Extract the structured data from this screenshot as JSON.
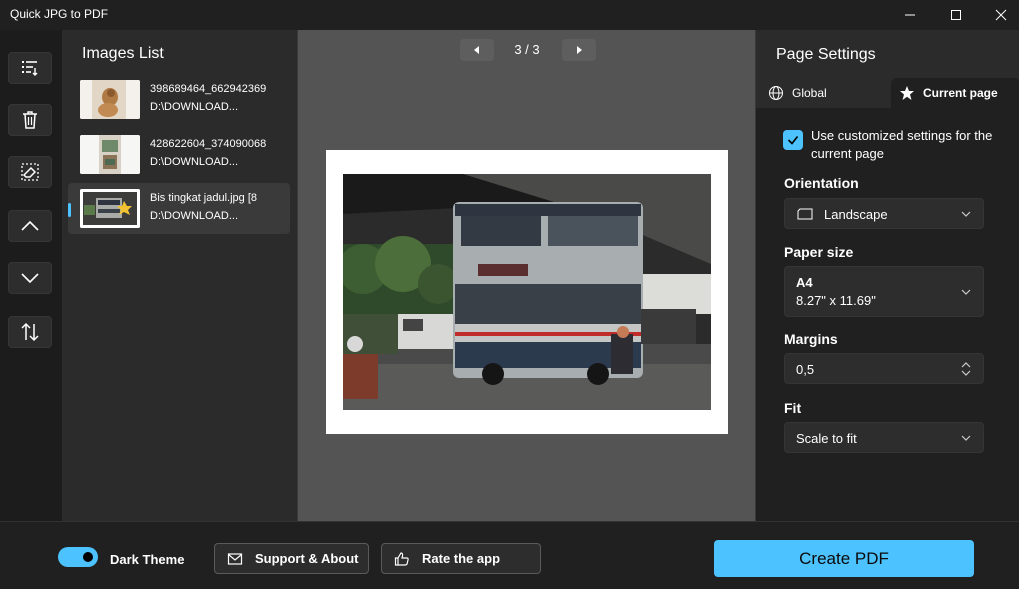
{
  "app": {
    "title": "Quick JPG to PDF"
  },
  "window_controls": [
    "minimize-icon",
    "maximize-icon",
    "close-icon"
  ],
  "toolbar": {
    "icons": [
      "list-options-icon",
      "delete-icon",
      "eraser-icon",
      "move-up-icon",
      "move-down-icon",
      "sort-icon"
    ]
  },
  "images_list": {
    "title": "Images List",
    "items": [
      {
        "name": "398689464_662942369",
        "path": "D:\\DOWNLOAD...",
        "selected": false
      },
      {
        "name": "428622604_374090068",
        "path": "D:\\DOWNLOAD...",
        "selected": false
      },
      {
        "name": "Bis tingkat jadul.jpg  [8",
        "path": "D:\\DOWNLOAD...",
        "selected": true
      }
    ]
  },
  "preview": {
    "page_indicator": "3 / 3"
  },
  "page_settings": {
    "title": "Page Settings",
    "tabs": {
      "global": "Global",
      "current": "Current page",
      "active": "current"
    },
    "use_custom": {
      "checked": true,
      "label": "Use customized settings for the current page"
    },
    "orientation": {
      "label": "Orientation",
      "value": "Landscape"
    },
    "paper_size": {
      "label": "Paper size",
      "value": "A4",
      "dimensions": "8.27\" x 11.69\""
    },
    "margins": {
      "label": "Margins",
      "value": "0,5"
    },
    "fit": {
      "label": "Fit",
      "value": "Scale to fit"
    }
  },
  "bottom": {
    "dark_theme": {
      "label": "Dark Theme",
      "on": true
    },
    "support_label": "Support & About",
    "rate_label": "Rate the app",
    "create_label": "Create PDF"
  },
  "colors": {
    "accent": "#4cc2ff",
    "background": "#202020",
    "panel": "#2b2b2b",
    "preview_bg": "#545454"
  }
}
